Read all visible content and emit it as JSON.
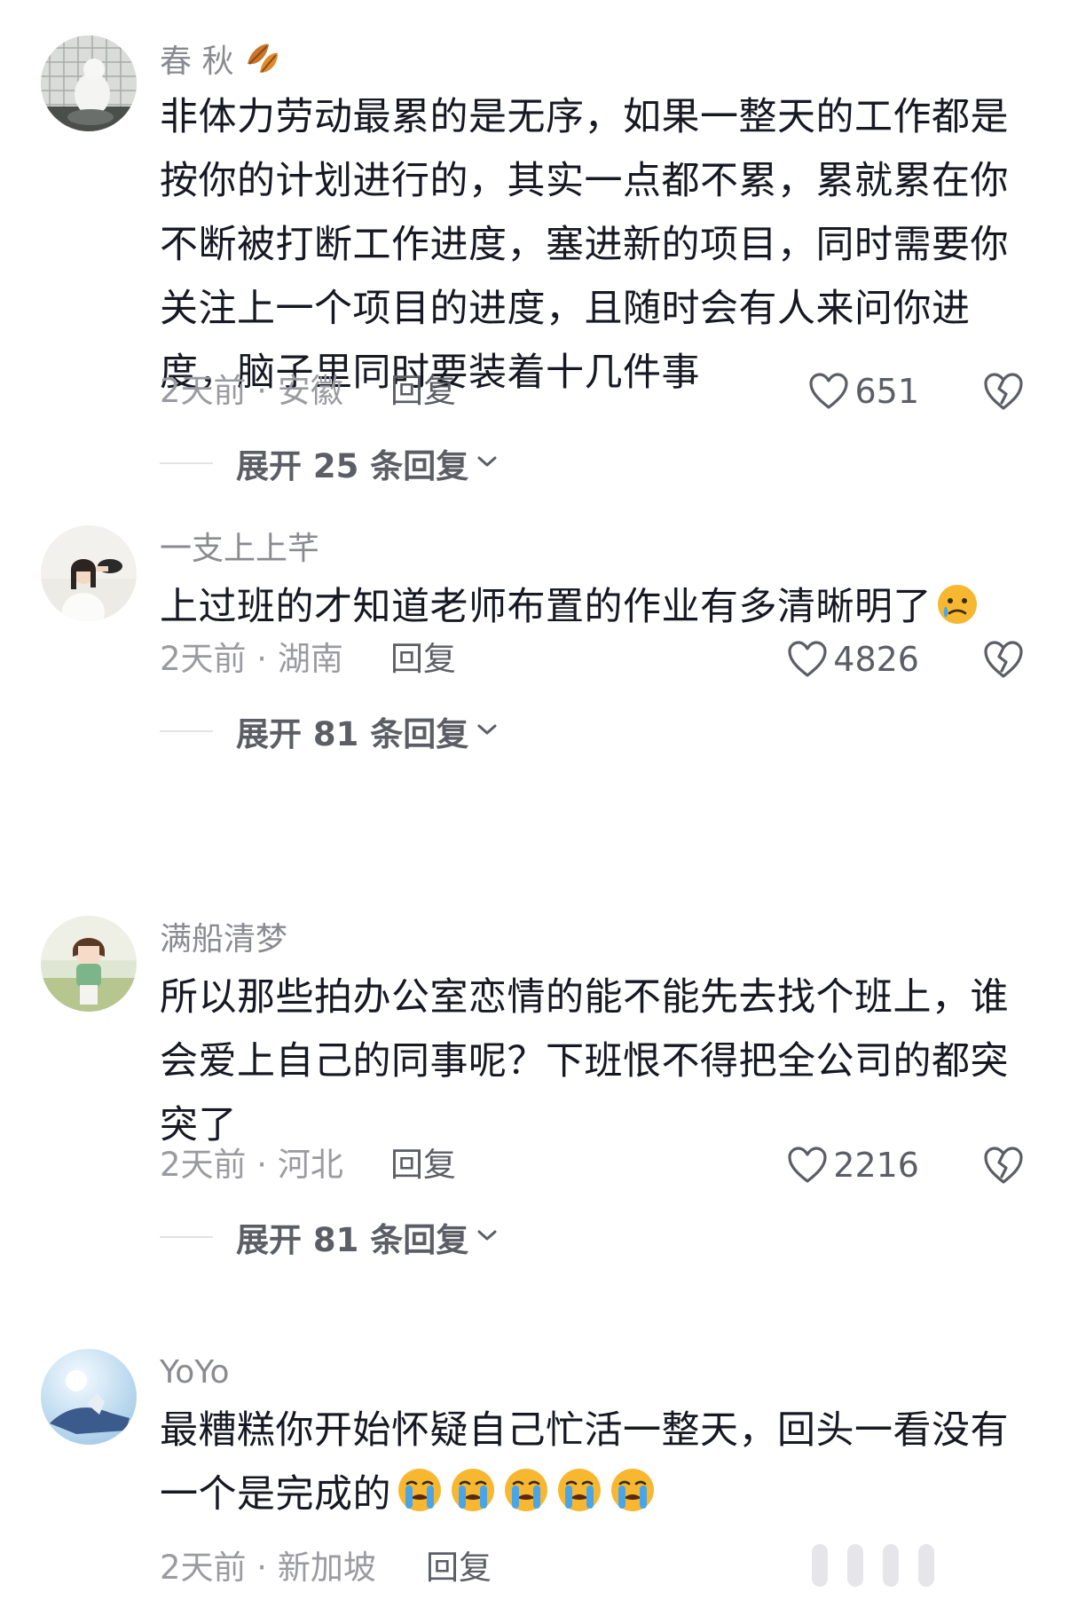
{
  "comments": [
    {
      "username": "春 秋",
      "username_emoji": "fallen-leaf",
      "text": "非体力劳动最累的是无序，如果一整天的工作都是按你的计划进行的，其实一点都不累，累就累在你不断被打断工作进度，塞进新的项目，同时需要你关注上一个项目的进度，且随时会有人来问你进度，脑子里同时要装着十几件事",
      "meta": "2天前 · 安徽",
      "reply_label": "回复",
      "likes": "651",
      "expand_label": "展开 25 条回复"
    },
    {
      "username": "一支上上芊",
      "text": "上过班的才知道老师布置的作业有多清晰明了",
      "text_emoji": "crying-face",
      "meta": "2天前 · 湖南",
      "reply_label": "回复",
      "likes": "4826",
      "expand_label": "展开 81 条回复"
    },
    {
      "username": "满船清梦",
      "text": "所以那些拍办公室恋情的能不能先去找个班上，谁会爱上自己的同事呢？下班恨不得把全公司的都突突了",
      "meta": "2天前 · 河北",
      "reply_label": "回复",
      "likes": "2216",
      "expand_label": "展开 81 条回复"
    },
    {
      "username": "YoYo",
      "text": "最糟糕你开始怀疑自己忙活一整天，回头一看没有一个是完成的",
      "text_emoji": "loudly-crying-face x5",
      "meta": "2天前 · 新加坡",
      "reply_label": "回复"
    }
  ],
  "icons": {
    "like": "heart-outline-icon",
    "dislike": "broken-heart-icon",
    "expand": "chevron-down-icon"
  },
  "colors": {
    "text_primary": "#161823",
    "text_secondary": "#8a8b91",
    "accent_emoji": "#f7b731"
  }
}
